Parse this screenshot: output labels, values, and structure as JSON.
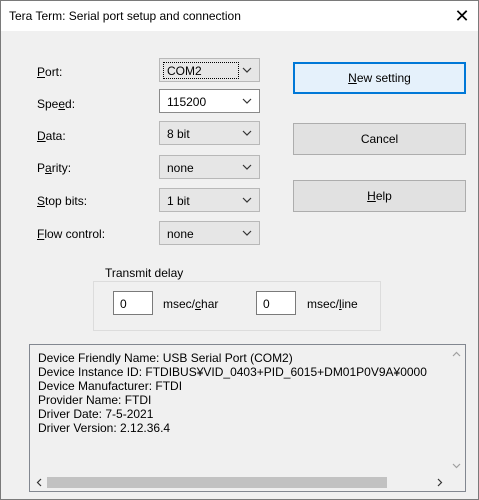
{
  "window": {
    "title": "Tera Term: Serial port setup and connection",
    "close_glyph": "✕"
  },
  "fields": {
    "port": {
      "label_mnemonic": "P",
      "label_rest": "ort:",
      "value": "COM2"
    },
    "speed": {
      "label_pre": "Spe",
      "label_mnemonic": "e",
      "label_rest": "d:",
      "value": "115200"
    },
    "data": {
      "label_mnemonic": "D",
      "label_rest": "ata:",
      "value": "8 bit"
    },
    "parity": {
      "label_pre": "P",
      "label_mnemonic": "a",
      "label_rest": "rity:",
      "value": "none"
    },
    "stop_bits": {
      "label_mnemonic": "S",
      "label_rest": "top bits:",
      "value": "1 bit"
    },
    "flow_control": {
      "label_mnemonic": "F",
      "label_rest": "low control:",
      "value": "none"
    }
  },
  "buttons": {
    "new_setting": {
      "mnemonic": "N",
      "rest": "ew setting"
    },
    "cancel": {
      "label": "Cancel"
    },
    "help": {
      "mnemonic": "H",
      "rest": "elp"
    }
  },
  "transmit_delay": {
    "title": "Transmit delay",
    "char_value": "0",
    "char_unit_pre": "msec/",
    "char_unit_mnemonic": "c",
    "char_unit_rest": "har",
    "line_value": "0",
    "line_unit_pre": "msec/",
    "line_unit_mnemonic": "l",
    "line_unit_rest": "ine"
  },
  "device_info": [
    "Device Friendly Name: USB Serial Port (COM2)",
    "Device Instance ID: FTDIBUS¥VID_0403+PID_6015+DM01P0V9A¥0000",
    "Device Manufacturer: FTDI",
    "Provider Name: FTDI",
    "Driver Date: 7-5-2021",
    "Driver Version: 2.12.36.4"
  ],
  "colors": {
    "dialog_bg": "#f0f0f0",
    "default_button_border": "#0078d7"
  },
  "icons": {
    "close": "close-icon",
    "dropdown": "chevron-down-icon",
    "scroll_up": "scroll-up-arrow-icon",
    "scroll_down": "scroll-down-arrow-icon",
    "scroll_left": "scroll-left-arrow-icon",
    "scroll_right": "scroll-right-arrow-icon"
  }
}
